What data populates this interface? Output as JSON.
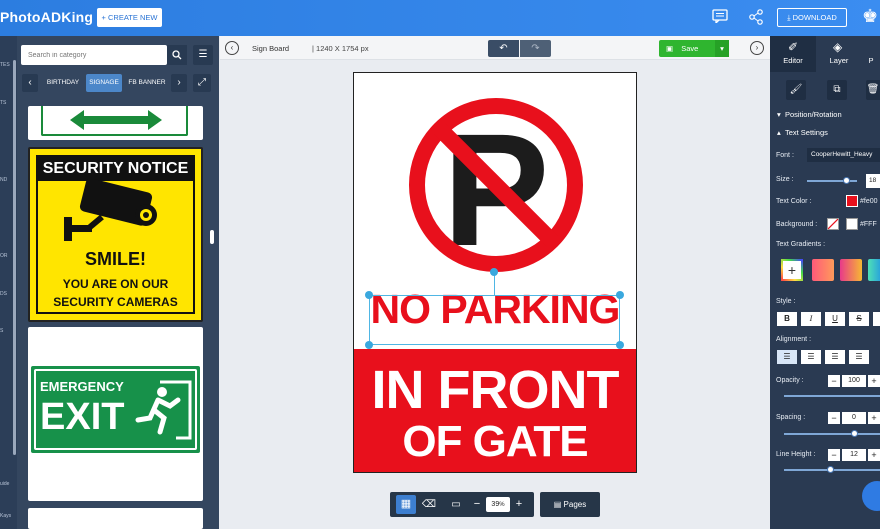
{
  "app": {
    "logo_text": "PhotoADKing",
    "create_new": "+ CREATE NEW",
    "download": "DOWNLOAD"
  },
  "left_categories": [
    "TES",
    "TS",
    "ND",
    "OR",
    "DS",
    "S",
    "uide",
    "Kays"
  ],
  "left_panel": {
    "search_placeholder": "Search in category",
    "tabs": [
      "BIRTHDAY",
      "SIGNAGE",
      "FB BANNER"
    ],
    "active_tab": "SIGNAGE",
    "thumbnails": [
      {
        "title": "SECURITY NOTICE",
        "line1": "SMILE!",
        "line2": "YOU ARE ON OUR",
        "line3": "SECURITY CAMERAS"
      },
      {
        "title": "EMERGENCY",
        "line1": "EXIT"
      }
    ]
  },
  "toolbar": {
    "doc_name": "Sign Board",
    "doc_size": "| 1240 X 1754 px",
    "save": "Save"
  },
  "canvas": {
    "headline": "NO PARKING",
    "line1": "IN FRONT",
    "line2": "OF GATE",
    "symbol_letter": "P",
    "colors": {
      "red": "#e8101c",
      "dark": "#1c1c1c"
    }
  },
  "bottom": {
    "zoom": "39",
    "zoom_unit": "%",
    "pages": "Pages"
  },
  "right_panel": {
    "tabs": [
      "Editor",
      "Layer",
      "P"
    ],
    "active_tab": "Editor",
    "sections": {
      "position": "Position/Rotation",
      "text": "Text Settings"
    },
    "font_label": "Font :",
    "font_value": "CooperHewitt_Heavy",
    "size_label": "Size :",
    "size_value": "18",
    "text_color_label": "Text Color :",
    "text_color_value": "#fe00",
    "background_label": "Background :",
    "background_value": "#FFF",
    "gradients_label": "Text Gradients :",
    "style_label": "Style :",
    "alignment_label": "Alignment :",
    "opacity_label": "Opacity :",
    "opacity_value": "100",
    "spacing_label": "Spacing :",
    "spacing_value": "0",
    "line_height_label": "Line Height :",
    "line_height_value": "12"
  }
}
